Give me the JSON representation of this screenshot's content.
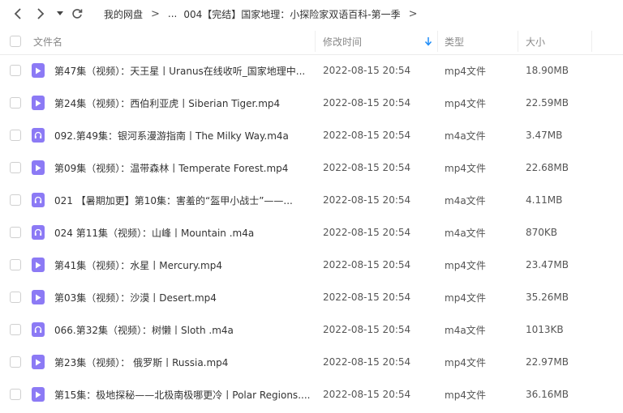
{
  "nav": {
    "crumbs": [
      "我的网盘",
      "...",
      "004【完结】国家地理：小探险家双语百科-第一季"
    ]
  },
  "columns": {
    "name": "文件名",
    "modified": "修改时间",
    "type": "类型",
    "size": "大小"
  },
  "colors": {
    "accent": "#1d8cf8",
    "file_icon": "#8c7af5"
  },
  "files": [
    {
      "name": "第47集（视频）：天王星丨Uranus在线收听_国家地理中...",
      "modified": "2022-08-15 20:54",
      "type": "mp4文件",
      "size": "18.90MB",
      "icon": "video-file-icon"
    },
    {
      "name": "第24集（视频）：西伯利亚虎丨Siberian Tiger.mp4",
      "modified": "2022-08-15 20:54",
      "type": "mp4文件",
      "size": "22.59MB",
      "icon": "video-file-icon"
    },
    {
      "name": "092.第49集：银河系漫游指南丨The Milky Way.m4a",
      "modified": "2022-08-15 20:54",
      "type": "m4a文件",
      "size": "3.47MB",
      "icon": "audio-file-icon"
    },
    {
      "name": "第09集（视频）：温带森林丨Temperate Forest.mp4",
      "modified": "2022-08-15 20:54",
      "type": "mp4文件",
      "size": "22.68MB",
      "icon": "video-file-icon"
    },
    {
      "name": "021 【暑期加更】第10集：害羞的“盔甲小战士”——...",
      "modified": "2022-08-15 20:54",
      "type": "m4a文件",
      "size": "4.11MB",
      "icon": "audio-file-icon"
    },
    {
      "name": "024 第11集（视频）：山峰丨Mountain .m4a",
      "modified": "2022-08-15 20:54",
      "type": "m4a文件",
      "size": "870KB",
      "icon": "audio-file-icon"
    },
    {
      "name": "第41集（视频）：水星丨Mercury.mp4",
      "modified": "2022-08-15 20:54",
      "type": "mp4文件",
      "size": "23.47MB",
      "icon": "video-file-icon"
    },
    {
      "name": "第03集（视频）：沙漠丨Desert.mp4",
      "modified": "2022-08-15 20:54",
      "type": "mp4文件",
      "size": "35.26MB",
      "icon": "video-file-icon"
    },
    {
      "name": "066.第32集（视频）：树懒丨Sloth .m4a",
      "modified": "2022-08-15 20:54",
      "type": "m4a文件",
      "size": "1013KB",
      "icon": "audio-file-icon"
    },
    {
      "name": "第23集（视频）： 俄罗斯丨Russia.mp4",
      "modified": "2022-08-15 20:54",
      "type": "mp4文件",
      "size": "22.97MB",
      "icon": "video-file-icon"
    },
    {
      "name": "第15集：极地探秘——北极南极哪更冷丨Polar Regions....",
      "modified": "2022-08-15 20:54",
      "type": "mp4文件",
      "size": "36.16MB",
      "icon": "video-file-icon"
    }
  ]
}
